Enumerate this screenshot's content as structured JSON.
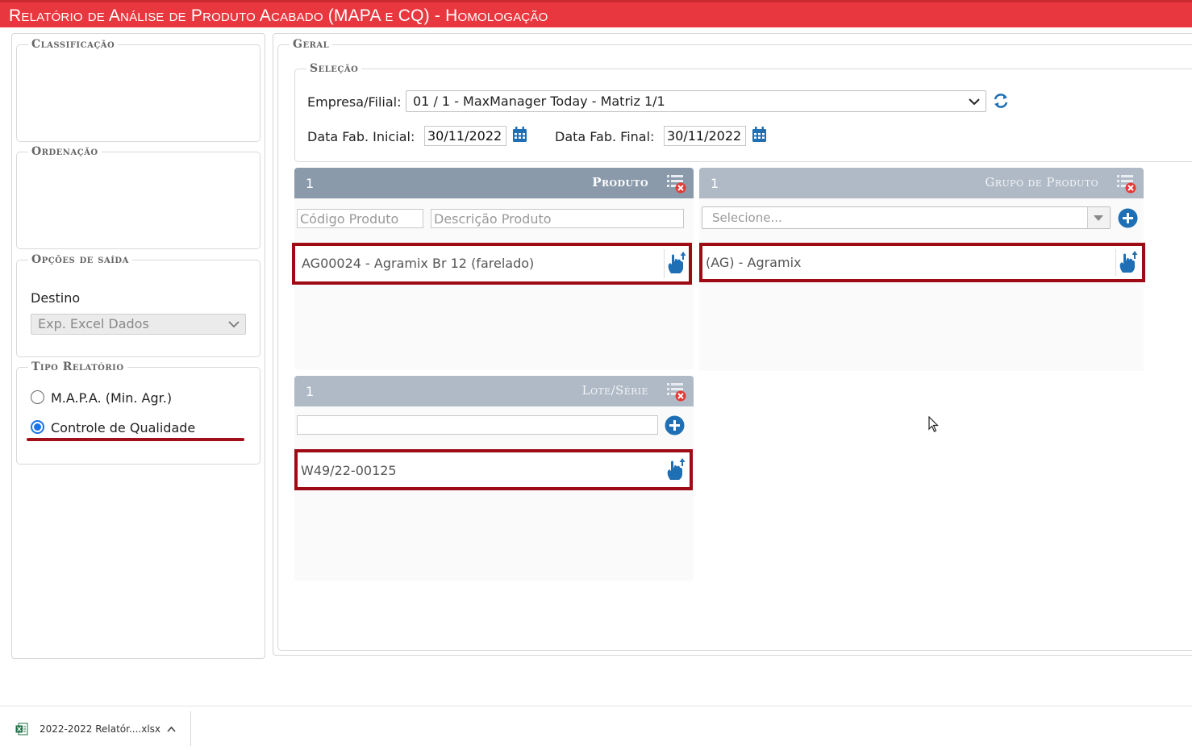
{
  "title": "Relatório de Análise de Produto Acabado (MAPA e CQ)   - Homologação",
  "left": {
    "classificacao_legend": "Classificação",
    "ordenacao_legend": "Ordenação",
    "saida_legend": "Opções de saída",
    "destino_label": "Destino",
    "destino_value": "Exp. Excel Dados",
    "tipo_legend": "Tipo Relatório",
    "radio_mapa": "M.A.P.A. (Min. Agr.)",
    "radio_cq": "Controle de Qualidade",
    "selected": "cq"
  },
  "geral": {
    "legend": "Geral",
    "selecao_legend": "Seleção",
    "empresa_label": "Empresa/Filial:",
    "empresa_value": "01 / 1 - MaxManager Today - Matriz 1/1",
    "data_ini_label": "Data Fab. Inicial:",
    "data_ini_value": "30/11/2022",
    "data_fim_label": "Data Fab. Final:",
    "data_fim_value": "30/11/2022"
  },
  "produto": {
    "count": "1",
    "title": "Produto",
    "codigo_placeholder": "Código Produto",
    "descricao_placeholder": "Descrição Produto",
    "item": "AG00024 - Agramix Br 12 (farelado)"
  },
  "grupo": {
    "count": "1",
    "title": "Grupo de Produto",
    "placeholder": "Selecione...",
    "item": "(AG) - Agramix"
  },
  "lote": {
    "count": "1",
    "title": "Lote/Série",
    "input_value": "",
    "item": "W49/22-00125"
  },
  "download": {
    "filename": "2022-2022 Relatór....xlsx"
  },
  "colors": {
    "title_bar": "#e8373e",
    "head_active": "#8a9aab",
    "head_inactive": "#afbac6",
    "highlight": "#9e0b15",
    "icon_blue": "#1f6fb5"
  }
}
